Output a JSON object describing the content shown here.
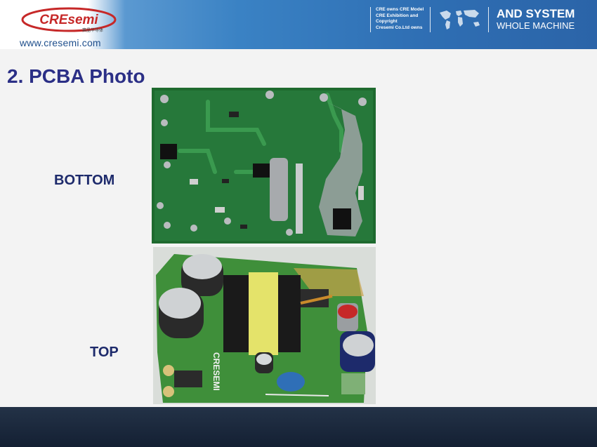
{
  "header": {
    "logo_text": "CREsemi",
    "logo_subtext": "赛晶半导体",
    "website": "www.cresemi.com",
    "notes": [
      "CRE owns CRE Model",
      "CRE Exhibition and",
      "Copyright",
      "Cresemi Co.Ltd owns"
    ],
    "tagline_line1": "AND SYSTEM",
    "tagline_line2": "WHOLE MACHINE"
  },
  "content": {
    "title": "2. PCBA Photo",
    "bottom_label": "BOTTOM",
    "top_label": "TOP"
  },
  "colors": {
    "header_blue": "#3a82c4",
    "title_navy": "#2b2f86",
    "footer_dark": "#1a273a",
    "pcb_green": "#1f6b2e",
    "logo_red": "#c62828"
  }
}
